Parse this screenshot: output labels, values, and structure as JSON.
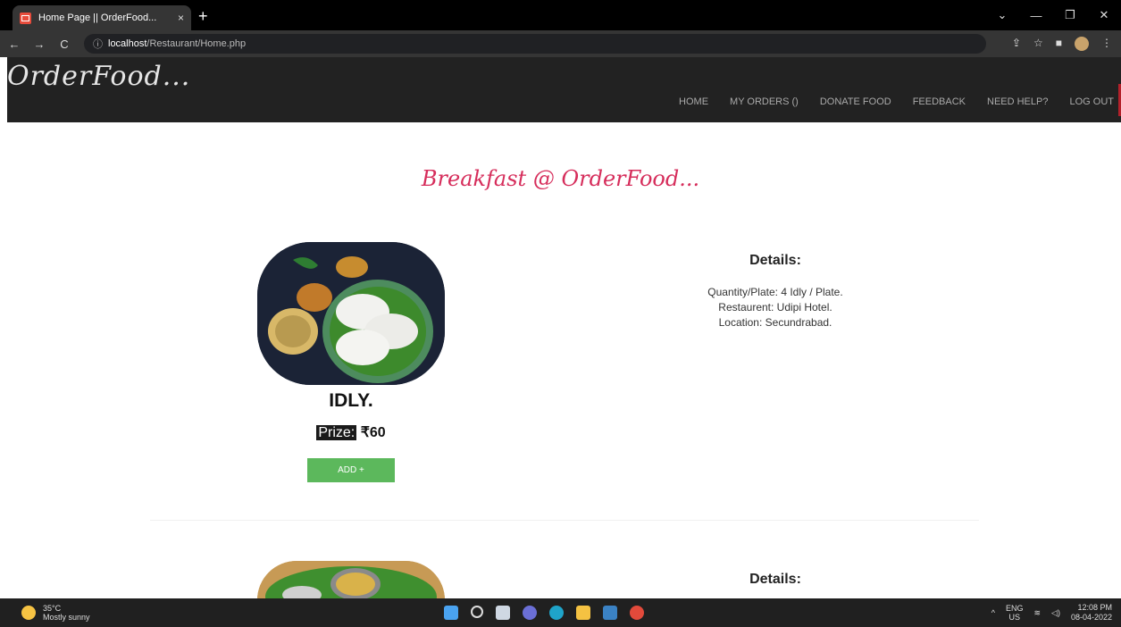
{
  "browser": {
    "tab_title": "Home Page || OrderFood...",
    "tab_close": "×",
    "new_tab": "+",
    "url_host": "localhost",
    "url_path": "/Restaurant/Home.php",
    "window_controls": [
      "⌄",
      "—",
      "❐",
      "✕"
    ]
  },
  "site": {
    "logo": "OrderFood...",
    "nav": [
      "HOME",
      "MY ORDERS ()",
      "DONATE FOOD",
      "FEEDBACK",
      "NEED HELP?",
      "LOG OUT"
    ],
    "heading": "Breakfast @ OrderFood..."
  },
  "items": [
    {
      "name": "IDLY.",
      "price_label": "Prize:",
      "price": "₹60",
      "add_label": "ADD +",
      "details_title": "Details:",
      "quantity": "Quantity/Plate: 4 Idly / Plate.",
      "restaurant": "Restaurent: Udipi Hotel.",
      "location": "Location: Secundrabad."
    },
    {
      "details_title": "Details:"
    }
  ],
  "taskbar": {
    "temp": "35°C",
    "weather": "Mostly sunny",
    "lang_top": "ENG",
    "lang_bottom": "US",
    "time": "12:08 PM",
    "date": "08-04-2022"
  }
}
